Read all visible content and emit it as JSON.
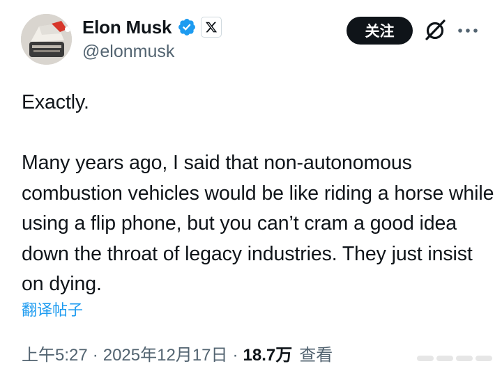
{
  "author": {
    "display_name": "Elon Musk",
    "handle": "@elonmusk",
    "verified": true
  },
  "actions": {
    "follow_label": "关注"
  },
  "post": {
    "paragraphs": [
      "Exactly.",
      "Many years ago, I said that non-autonomous combustion vehicles would be like riding a horse while using a flip phone, but you can’t cram a good idea down the throat of legacy industries. They just insist on dying."
    ],
    "translate_label": "翻译帖子"
  },
  "meta": {
    "time": "上午5:27",
    "separator": "·",
    "date": "2025年12月17日",
    "views": "18.7万",
    "views_label": "查看"
  },
  "icons": {
    "verified_badge": "verified-badge-icon",
    "affiliate": "x-logo-icon",
    "grok": "grok-icon",
    "more": "more-icon"
  },
  "colors": {
    "text": "#0f1419",
    "secondary": "#536471",
    "accent": "#1d9bf0",
    "button_bg": "#0f1419"
  }
}
